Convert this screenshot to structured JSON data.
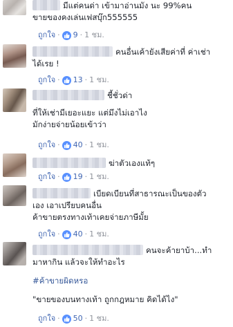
{
  "comments": [
    {
      "line1": "มีแต่คนด่า เข้ามาอ่านมัง นะ 99%คน",
      "line2": "ขายของคงเล่นเฟสบุ๊ก555555",
      "like_label": "ถูกใจ",
      "likes": "9",
      "time": "1 ชม."
    },
    {
      "line1": "คนอื่นเค้ายังเสียค่าที่ ค่าเช่า",
      "line2": "ได้เรย !",
      "like_label": "ถูกใจ",
      "likes": "13",
      "time": "1 ชม."
    },
    {
      "line1": "ชี้ชั่วด่า",
      "line2": "ที่ให้เช่ามีเยอะแยะ แต่มึงไม่เอาไง",
      "line3": "มักง่ายจ่ายน้อยเข้าว่า",
      "like_label": "ถูกใจ",
      "likes": "40",
      "time": "1 ชม."
    },
    {
      "line1": "ฆ่าตัวเองแท้ๆ",
      "like_label": "ถูกใจ",
      "likes": "19",
      "time": "1 ชม."
    },
    {
      "line1": "เบียดเบียนที่สาธารณะเป็นของตัว",
      "line2": "เอง เอาเปรียบคนอื่น",
      "line3": "ค้าขายตรงทางเท้าเคยจ่ายภาษีมั้ย",
      "like_label": "ถูกใจ",
      "likes": "40",
      "time": "1 ชม."
    },
    {
      "line1": "คนจะค้ายาบ้า...ทำ",
      "line2": "มาหากิน แล้วจะให้ทำอะไร",
      "hashtag": "#ค้าขายผิดหรอ",
      "line3": "\"ขายของบนทางเท้า ถูกกฎหมาย คิดได้ไง\"",
      "like_label": "ถูกใจ",
      "likes": "50",
      "time": "1 ชม."
    }
  ]
}
